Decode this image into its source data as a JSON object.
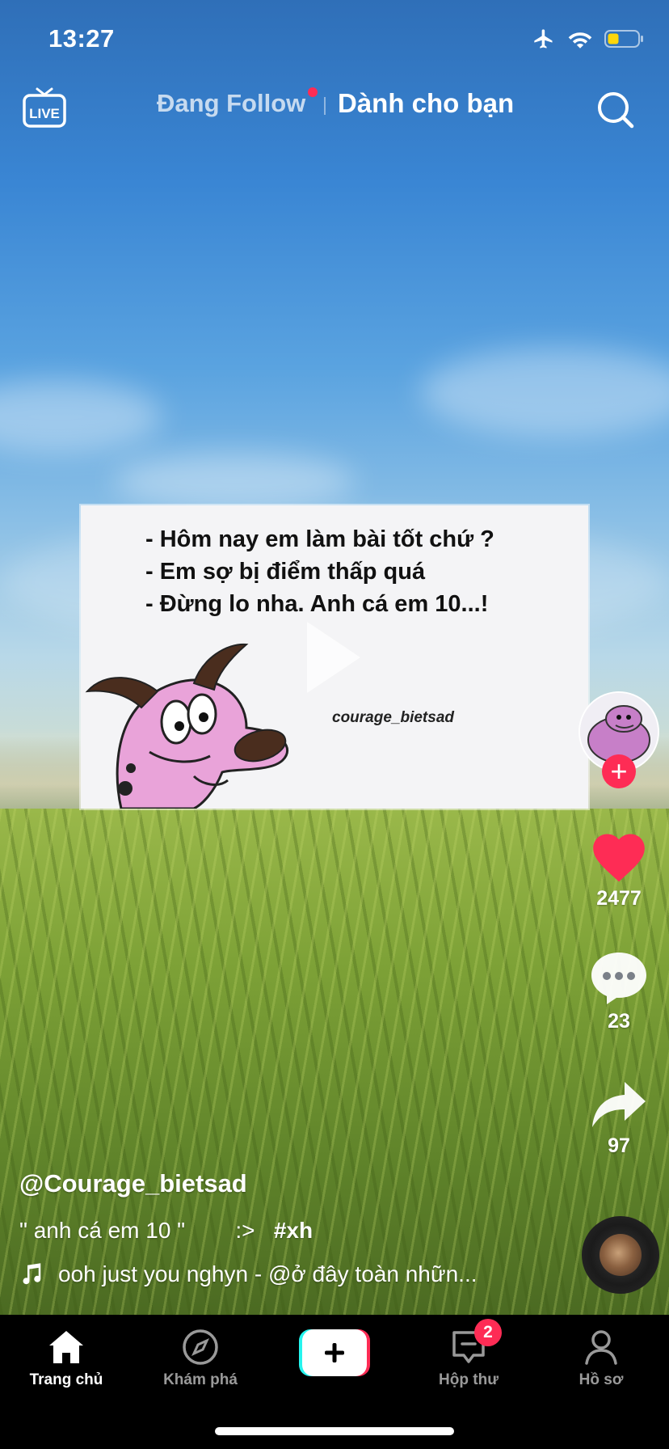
{
  "status_bar": {
    "time": "13:27"
  },
  "top_nav": {
    "live_label": "LIVE",
    "tab_following": "Đang Follow",
    "tab_for_you": "Dành cho bạn"
  },
  "video": {
    "meme_lines": [
      "- Hôm nay em làm bài tốt chứ ?",
      "- Em sợ bị điểm thấp quá",
      "- Đừng lo nha. Anh cá em 10...!"
    ],
    "meme_watermark": "courage_bietsad"
  },
  "side_rail": {
    "likes": "2477",
    "comments": "23",
    "shares": "97",
    "accent_color": "#fe2c55"
  },
  "caption": {
    "author": "@Courage_bietsad",
    "description": "\" anh cá em 10 \"        :>   ",
    "hashtag": "#xh",
    "music": "ooh just you nghyn - @ở đây toàn nhữn..."
  },
  "bottom_nav": {
    "home": "Trang chủ",
    "discover": "Khám phá",
    "inbox": "Hộp thư",
    "inbox_badge": "2",
    "profile": "Hồ sơ"
  }
}
